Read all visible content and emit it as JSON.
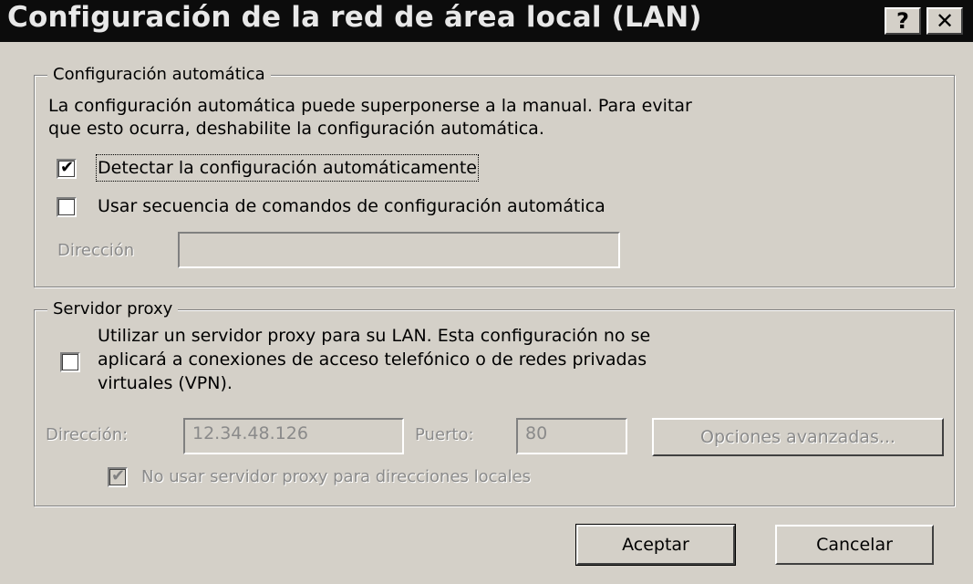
{
  "window": {
    "title": "Configuración de la red de área local (LAN)",
    "help_label": "?",
    "close_label": "✕"
  },
  "auto_config": {
    "legend": "Configuración automática",
    "description_line1": "La configuración automática puede superponerse a la manual. Para evitar",
    "description_line2": "que esto ocurra, deshabilite la configuración automática.",
    "detect_label": "Detectar la configuración automáticamente",
    "detect_checked": true,
    "script_label": "Usar secuencia de comandos de configuración automática",
    "script_checked": false,
    "address_label": "Dirección",
    "address_value": ""
  },
  "proxy": {
    "legend": "Servidor proxy",
    "use_proxy_line1": "Utilizar un servidor proxy para su LAN. Esta configuración no se",
    "use_proxy_line2": "aplicará a conexiones de acceso telefónico o de redes privadas",
    "use_proxy_line3": "virtuales (VPN).",
    "use_proxy_checked": false,
    "address_label": "Dirección:",
    "address_value": "12.34.48.126",
    "port_label": "Puerto:",
    "port_value": "80",
    "advanced_label": "Opciones avanzadas...",
    "bypass_label": "No usar servidor proxy para direcciones locales",
    "bypass_checked": true
  },
  "buttons": {
    "ok_label": "Aceptar",
    "cancel_label": "Cancelar"
  },
  "colors": {
    "dialog_bg": "#d4d0c8",
    "titlebar_bg": "#0c0c0c",
    "disabled_text": "#8a8a8a"
  }
}
